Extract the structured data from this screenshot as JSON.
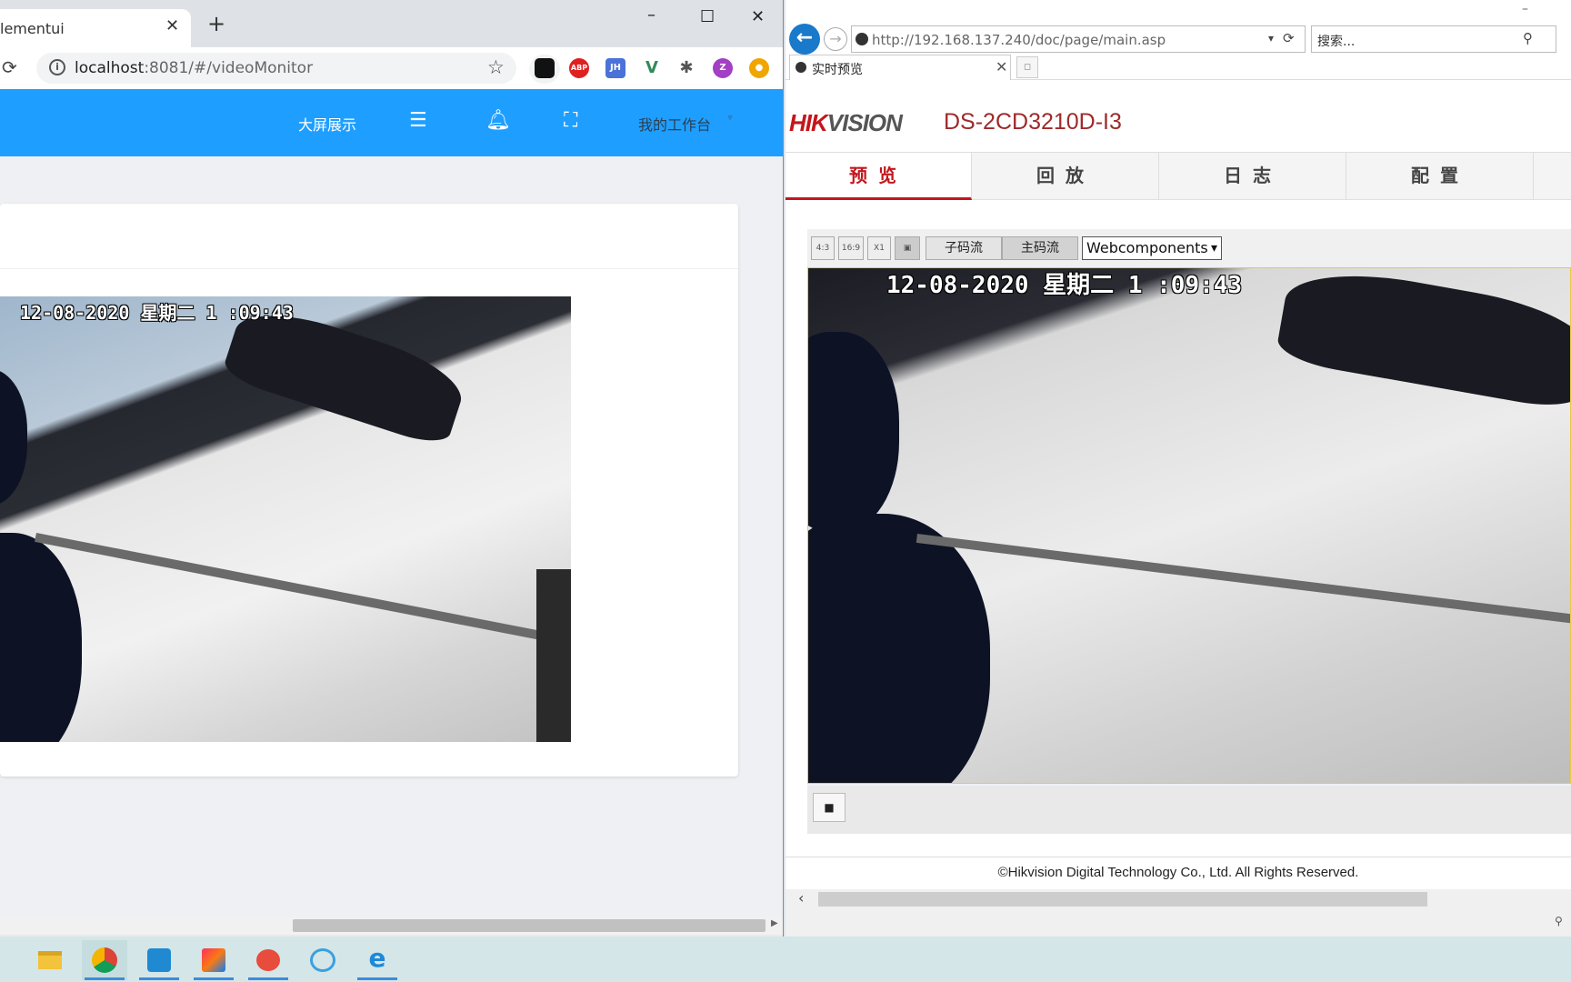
{
  "chrome": {
    "tab_title": "lementui",
    "tab_close": "✕",
    "new_tab": "+",
    "window_controls": [
      "–",
      "☐",
      "✕"
    ],
    "url_host": "localhost",
    "url_rest": ":8081/#/videoMonitor",
    "extensions": [
      "ABP",
      "JH",
      "V",
      "Z"
    ],
    "appbar": {
      "bigscreen_label": "大屏展示",
      "menu_icon": "menu-icon",
      "bell_icon": "bell-icon",
      "fullscreen_icon": "fullscreen-icon",
      "workbench_label": "我的工作台"
    },
    "video_osd": "12-08-2020 星期二 1 :09:43"
  },
  "ie": {
    "url_host": "http://192.168.137.240",
    "url_rest": "/doc/page/main.asp",
    "search_placeholder": "搜索...",
    "tab_title": "实时预览",
    "tab_close": "✕",
    "logo_red": "HIK",
    "logo_grey": "VISION",
    "model": "DS-2CD3210D-I3",
    "menus": [
      "预览",
      "回放",
      "日志",
      "配置"
    ],
    "ratio_buttons": [
      "4:3",
      "16:9",
      "X1"
    ],
    "substream_label": "子码流",
    "mainstream_label": "主码流",
    "plugin_select": "Webcomponents",
    "video_osd": "12-08-2020 星期二 1  :09:43",
    "stop_label": "■",
    "footer": "©Hikvision Digital Technology Co., Ltd. All Rights Reserved."
  },
  "taskbar": {
    "apps": [
      "file-explorer",
      "chrome",
      "vscode",
      "intellij",
      "snail-app",
      "network-app",
      "internet-explorer"
    ]
  },
  "colors": {
    "appbar_blue": "#1e9fff",
    "hik_red": "#c4161c",
    "model_red": "#9e2a2b",
    "taskbar": "#d4e6e8"
  }
}
